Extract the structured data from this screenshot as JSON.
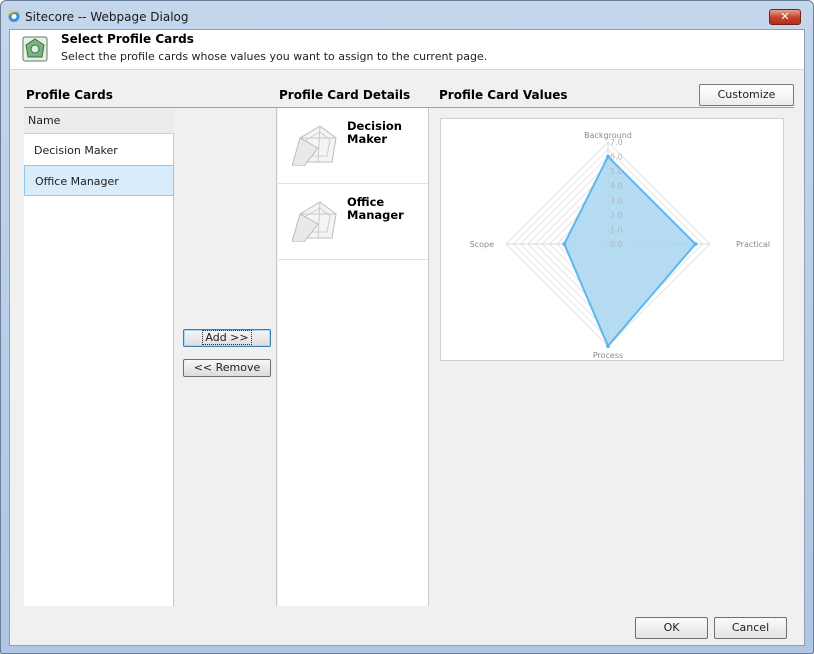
{
  "window": {
    "title": "Sitecore -- Webpage Dialog",
    "close_label": "✕"
  },
  "header": {
    "title": "Select Profile Cards",
    "description": "Select the profile cards whose values you want to assign to the current page."
  },
  "sections": {
    "profile_cards": "Profile Cards",
    "details": "Profile Card Details",
    "values": "Profile Card Values",
    "customize_label": "Customize"
  },
  "profile_list": {
    "column_header": "Name",
    "items": [
      "Decision Maker",
      "Office Manager"
    ],
    "selected_index": 1
  },
  "actions": {
    "add_label": "Add >>",
    "remove_label": "<< Remove"
  },
  "details": {
    "items": [
      "Decision Maker",
      "Office Manager"
    ]
  },
  "footer": {
    "ok_label": "OK",
    "cancel_label": "Cancel"
  },
  "colors": {
    "series_fill": "#a9d6f2",
    "series_stroke": "#5cb8ec",
    "selection": "#d9ecfb"
  },
  "chart_data": {
    "type": "radar",
    "axes": [
      "Background",
      "Practical",
      "Process",
      "Scope"
    ],
    "range": [
      0,
      7
    ],
    "ticks": [
      "0.0",
      "1.0",
      "2.0",
      "3.0",
      "4.0",
      "5.0",
      "6.0",
      "7.0"
    ],
    "series": [
      {
        "values": [
          6,
          6,
          7,
          3
        ]
      }
    ]
  }
}
